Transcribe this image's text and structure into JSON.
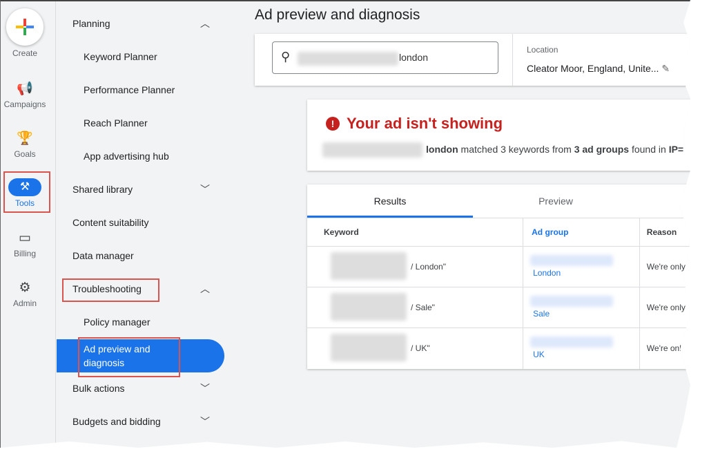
{
  "rail": {
    "create": "Create",
    "campaigns": "Campaigns",
    "goals": "Goals",
    "tools": "Tools",
    "billing": "Billing",
    "admin": "Admin"
  },
  "nav": {
    "planning": "Planning",
    "keyword_planner": "Keyword Planner",
    "performance_planner": "Performance Planner",
    "reach_planner": "Reach Planner",
    "app_hub": "App advertising hub",
    "shared_library": "Shared library",
    "content_suitability": "Content suitability",
    "data_manager": "Data manager",
    "troubleshooting": "Troubleshooting",
    "policy_manager": "Policy manager",
    "ad_preview": "Ad preview and diagnosis",
    "bulk_actions": "Bulk actions",
    "budgets": "Budgets and bidding"
  },
  "page_title": "Ad preview and diagnosis",
  "search": {
    "value": "london"
  },
  "location": {
    "label": "Location",
    "value": "Cleator Moor, England, Unite..."
  },
  "alert": {
    "title": "Your ad isn't showing",
    "term": "london",
    "m1": " matched 3 keywords from ",
    "bold2": "3 ad groups",
    "m2": " found in ",
    "bold3": "IP="
  },
  "tabs": {
    "results": "Results",
    "preview": "Preview"
  },
  "table": {
    "headers": [
      "Keyword",
      "Ad group",
      "Reason"
    ],
    "rows": [
      {
        "kw": "/ London\"",
        "ag": "London",
        "reason": "We're only"
      },
      {
        "kw": "/ Sale\"",
        "ag": "Sale",
        "reason": "We're only"
      },
      {
        "kw": "/ UK\"",
        "ag": "UK",
        "reason": "We're only"
      }
    ]
  },
  "colors": {
    "accent": "#1a73e8",
    "error": "#c5221f",
    "highlight": "#d9534f"
  }
}
